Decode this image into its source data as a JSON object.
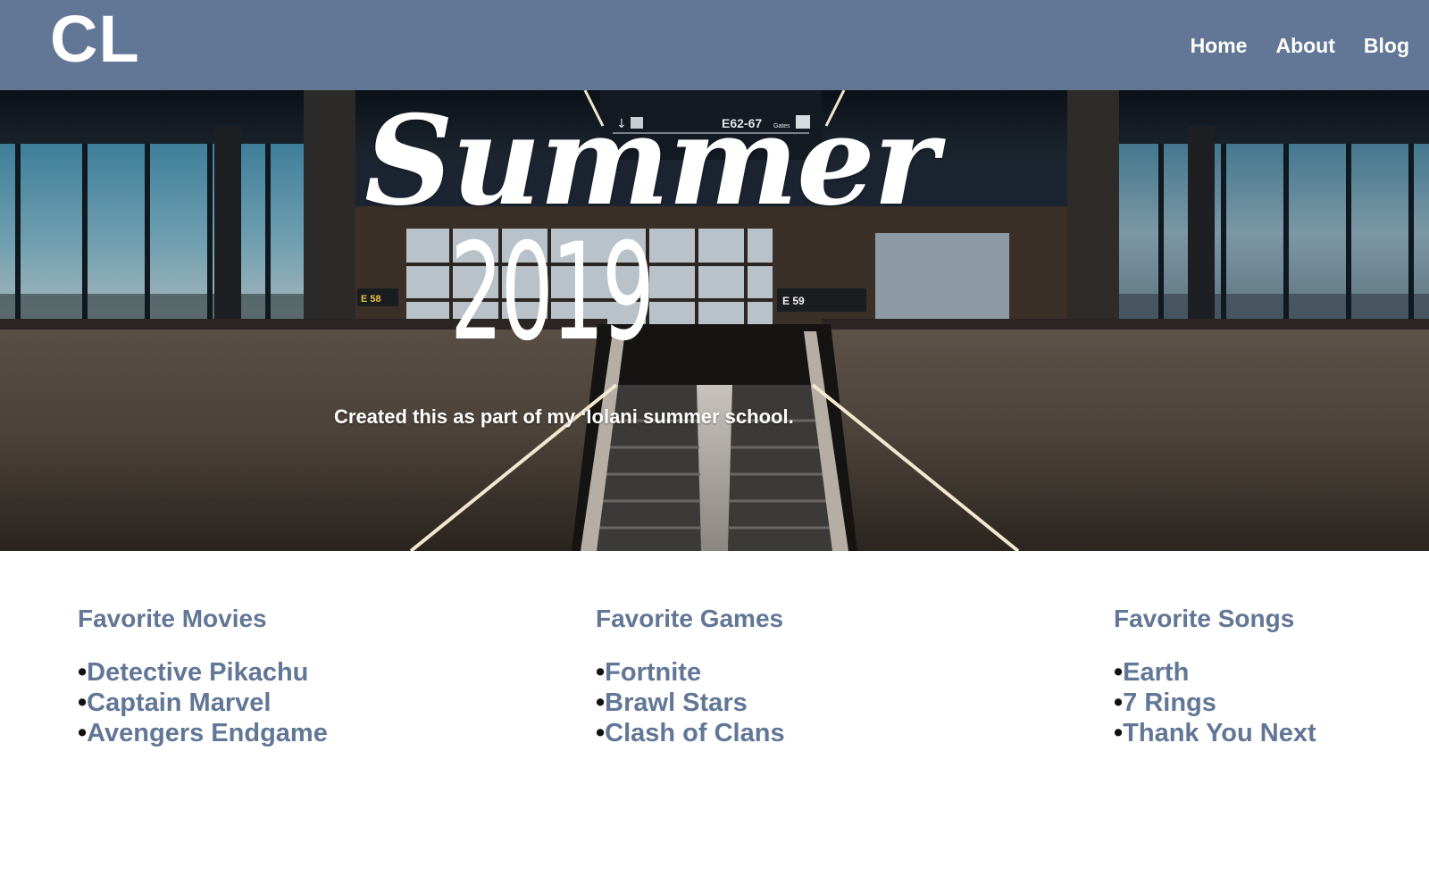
{
  "header": {
    "logo": "CL",
    "nav": [
      "Home",
      "About",
      "Blog"
    ]
  },
  "hero": {
    "title": "Summer",
    "year": "2019",
    "caption": "Created this as part of my ‘Iolani summer school.",
    "sign_text": "E62-67",
    "sign_sub": "Gates",
    "gate_left": "E 58",
    "gate_right": "E 59"
  },
  "columns": [
    {
      "heading": "Favorite Movies",
      "items": [
        "Detective Pikachu",
        "Captain Marvel",
        "Avengers Endgame"
      ]
    },
    {
      "heading": "Favorite Games",
      "items": [
        "Fortnite",
        "Brawl Stars",
        "Clash of Clans"
      ]
    },
    {
      "heading": "Favorite Songs",
      "items": [
        "Earth",
        "7 Rings",
        "Thank You Next"
      ]
    }
  ],
  "bullet": "•",
  "colors": {
    "header_bg": "#627695",
    "accent_text": "#627695",
    "hero_text": "#ffffff"
  }
}
